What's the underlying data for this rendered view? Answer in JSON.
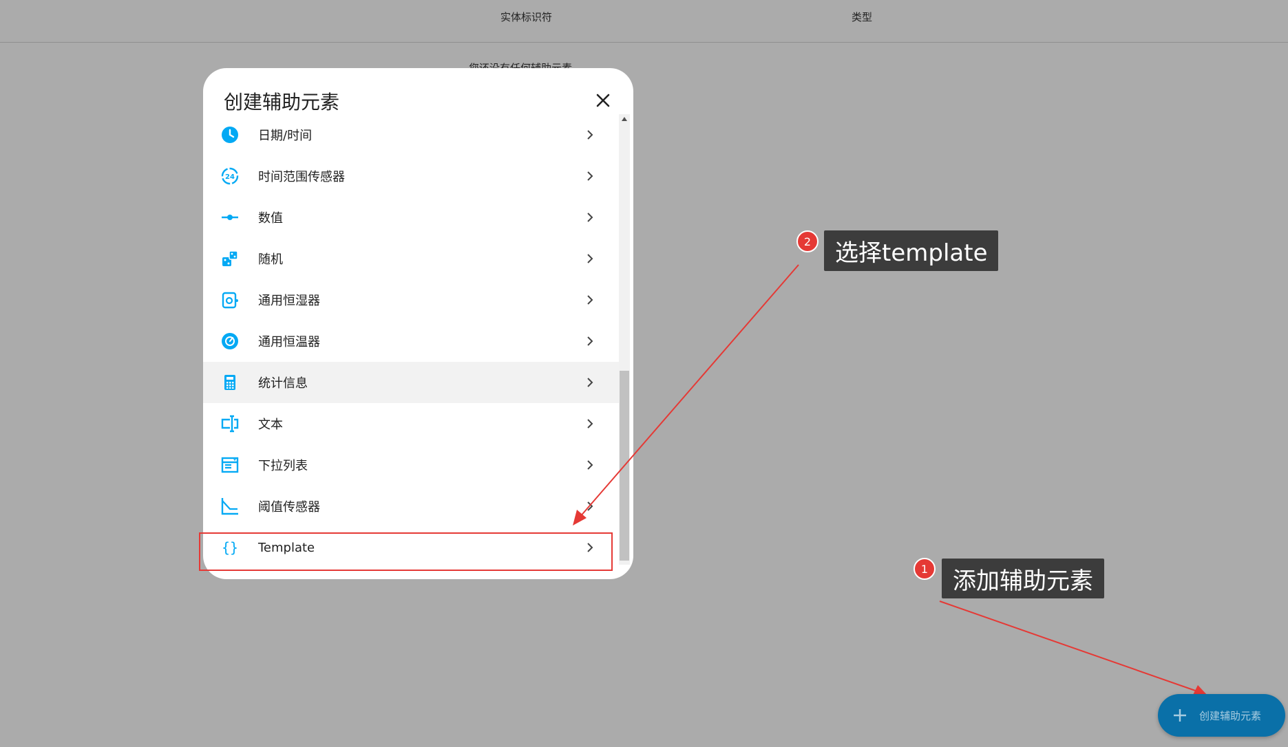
{
  "background": {
    "columns": [
      "实体标识符",
      "类型"
    ],
    "empty_message": "您还没有任何辅助元素"
  },
  "dialog": {
    "title": "创建辅助元素",
    "items": [
      {
        "label": "日期/时间",
        "icon": "clock-icon"
      },
      {
        "label": "时间范围传感器",
        "icon": "hours-24-icon"
      },
      {
        "label": "数值",
        "icon": "slider-icon"
      },
      {
        "label": "随机",
        "icon": "dice-icon"
      },
      {
        "label": "通用恒湿器",
        "icon": "humidifier-icon"
      },
      {
        "label": "通用恒温器",
        "icon": "thermostat-icon"
      },
      {
        "label": "统计信息",
        "icon": "calculator-icon"
      },
      {
        "label": "文本",
        "icon": "text-input-icon"
      },
      {
        "label": "下拉列表",
        "icon": "dropdown-list-icon"
      },
      {
        "label": "阈值传感器",
        "icon": "threshold-chart-icon"
      },
      {
        "label": "Template",
        "icon": "code-braces-icon"
      }
    ]
  },
  "annotations": {
    "step1": {
      "number": "1",
      "text": "添加辅助元素"
    },
    "step2": {
      "number": "2",
      "text": "选择template"
    }
  },
  "fab": {
    "label": "创建辅助元素"
  },
  "colors": {
    "accent": "#03a9f4",
    "annotation_red": "#e53935",
    "fab_bg": "#0a70a8",
    "overlay": "#ababab"
  }
}
